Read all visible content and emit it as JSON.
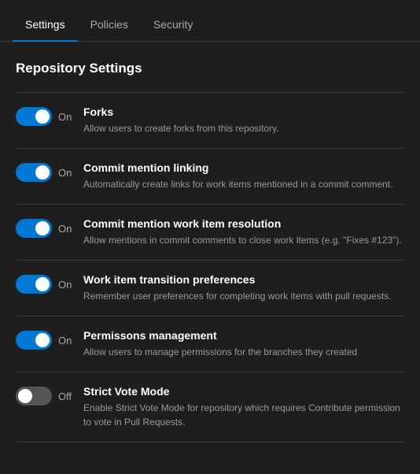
{
  "nav": {
    "tabs": [
      {
        "id": "settings",
        "label": "Settings",
        "active": true
      },
      {
        "id": "policies",
        "label": "Policies",
        "active": false
      },
      {
        "id": "security",
        "label": "Security",
        "active": false
      }
    ]
  },
  "section": {
    "title": "Repository Settings"
  },
  "settings": [
    {
      "id": "forks",
      "state": "on",
      "name": "Forks",
      "description": "Allow users to create forks from this repository."
    },
    {
      "id": "commit-mention-linking",
      "state": "on",
      "name": "Commit mention linking",
      "description": "Automatically create links for work items mentioned in a commit comment."
    },
    {
      "id": "commit-mention-resolution",
      "state": "on",
      "name": "Commit mention work item resolution",
      "description": "Allow mentions in commit comments to close work items (e.g. \"Fixes #123\")."
    },
    {
      "id": "work-item-transition",
      "state": "on",
      "name": "Work item transition preferences",
      "description": "Remember user preferences for completing work items with pull requests."
    },
    {
      "id": "permissions-management",
      "state": "on",
      "name": "Permissons management",
      "description": "Allow users to manage permissions for the branches they created"
    },
    {
      "id": "strict-vote-mode",
      "state": "off",
      "name": "Strict Vote Mode",
      "description": "Enable Strict Vote Mode for repository which requires Contribute permission to vote in Pull Requests."
    }
  ],
  "labels": {
    "on": "On",
    "off": "Off"
  }
}
